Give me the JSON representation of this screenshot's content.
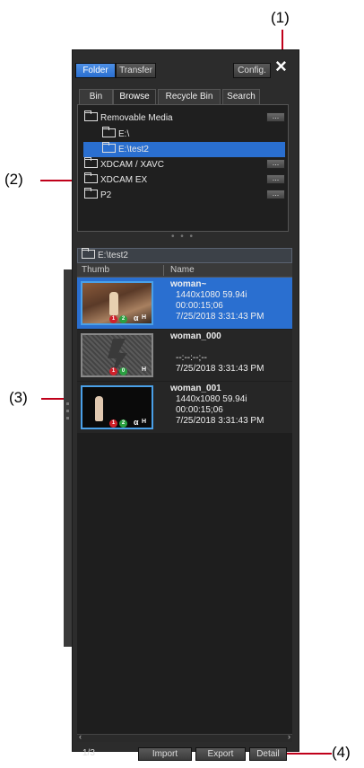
{
  "callouts": {
    "c1": "(1)",
    "c2": "(2)",
    "c3": "(3)",
    "c4": "(4)"
  },
  "top_tabs": {
    "folder": "Folder",
    "transfer": "Transfer",
    "config": "Config."
  },
  "close_glyph": "×",
  "tabs": {
    "bin": "Bin",
    "browse": "Browse",
    "recycle": "Recycle Bin",
    "search": "Search"
  },
  "tree": {
    "removable": "Removable Media",
    "e_drive": "E:\\",
    "e_test2": "E:\\test2",
    "xdcam_xavc": "XDCAM / XAVC",
    "xdcam_ex": "XDCAM EX",
    "p2": "P2",
    "more": "..."
  },
  "path": "E:\\test2",
  "columns": {
    "thumb": "Thumb",
    "name": "Name"
  },
  "clips": [
    {
      "name": "woman~",
      "format": "1440x1080 59.94i",
      "duration": "00:00:15;06",
      "date": "7/25/2018 3:31:43 PM"
    },
    {
      "name": "woman_000",
      "format": "",
      "duration": "--:--:--;--",
      "date": "7/25/2018 3:31:43 PM"
    },
    {
      "name": "woman_001",
      "format": "1440x1080 59.94i",
      "duration": "00:00:15;06",
      "date": "7/25/2018 3:31:43 PM"
    }
  ],
  "badges": {
    "one": "1",
    "two": "2",
    "zero": "0",
    "alpha": "α",
    "h": "H"
  },
  "footer": {
    "page": "1/3",
    "import": "Import",
    "export": "Export",
    "detail": "Detail"
  },
  "colors": {
    "accent": "#2a6fd0",
    "callout_line": "#c0001a",
    "panel": "#2c2c2c"
  }
}
